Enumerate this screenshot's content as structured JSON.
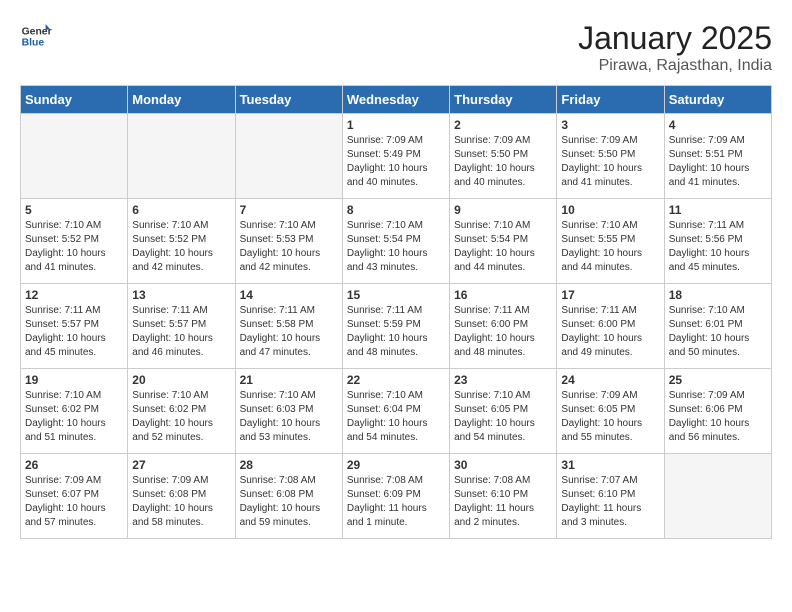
{
  "header": {
    "logo_line1": "General",
    "logo_line2": "Blue",
    "month": "January 2025",
    "location": "Pirawa, Rajasthan, India"
  },
  "weekdays": [
    "Sunday",
    "Monday",
    "Tuesday",
    "Wednesday",
    "Thursday",
    "Friday",
    "Saturday"
  ],
  "weeks": [
    [
      {
        "day": "",
        "detail": ""
      },
      {
        "day": "",
        "detail": ""
      },
      {
        "day": "",
        "detail": ""
      },
      {
        "day": "1",
        "detail": "Sunrise: 7:09 AM\nSunset: 5:49 PM\nDaylight: 10 hours\nand 40 minutes."
      },
      {
        "day": "2",
        "detail": "Sunrise: 7:09 AM\nSunset: 5:50 PM\nDaylight: 10 hours\nand 40 minutes."
      },
      {
        "day": "3",
        "detail": "Sunrise: 7:09 AM\nSunset: 5:50 PM\nDaylight: 10 hours\nand 41 minutes."
      },
      {
        "day": "4",
        "detail": "Sunrise: 7:09 AM\nSunset: 5:51 PM\nDaylight: 10 hours\nand 41 minutes."
      }
    ],
    [
      {
        "day": "5",
        "detail": "Sunrise: 7:10 AM\nSunset: 5:52 PM\nDaylight: 10 hours\nand 41 minutes."
      },
      {
        "day": "6",
        "detail": "Sunrise: 7:10 AM\nSunset: 5:52 PM\nDaylight: 10 hours\nand 42 minutes."
      },
      {
        "day": "7",
        "detail": "Sunrise: 7:10 AM\nSunset: 5:53 PM\nDaylight: 10 hours\nand 42 minutes."
      },
      {
        "day": "8",
        "detail": "Sunrise: 7:10 AM\nSunset: 5:54 PM\nDaylight: 10 hours\nand 43 minutes."
      },
      {
        "day": "9",
        "detail": "Sunrise: 7:10 AM\nSunset: 5:54 PM\nDaylight: 10 hours\nand 44 minutes."
      },
      {
        "day": "10",
        "detail": "Sunrise: 7:10 AM\nSunset: 5:55 PM\nDaylight: 10 hours\nand 44 minutes."
      },
      {
        "day": "11",
        "detail": "Sunrise: 7:11 AM\nSunset: 5:56 PM\nDaylight: 10 hours\nand 45 minutes."
      }
    ],
    [
      {
        "day": "12",
        "detail": "Sunrise: 7:11 AM\nSunset: 5:57 PM\nDaylight: 10 hours\nand 45 minutes."
      },
      {
        "day": "13",
        "detail": "Sunrise: 7:11 AM\nSunset: 5:57 PM\nDaylight: 10 hours\nand 46 minutes."
      },
      {
        "day": "14",
        "detail": "Sunrise: 7:11 AM\nSunset: 5:58 PM\nDaylight: 10 hours\nand 47 minutes."
      },
      {
        "day": "15",
        "detail": "Sunrise: 7:11 AM\nSunset: 5:59 PM\nDaylight: 10 hours\nand 48 minutes."
      },
      {
        "day": "16",
        "detail": "Sunrise: 7:11 AM\nSunset: 6:00 PM\nDaylight: 10 hours\nand 48 minutes."
      },
      {
        "day": "17",
        "detail": "Sunrise: 7:11 AM\nSunset: 6:00 PM\nDaylight: 10 hours\nand 49 minutes."
      },
      {
        "day": "18",
        "detail": "Sunrise: 7:10 AM\nSunset: 6:01 PM\nDaylight: 10 hours\nand 50 minutes."
      }
    ],
    [
      {
        "day": "19",
        "detail": "Sunrise: 7:10 AM\nSunset: 6:02 PM\nDaylight: 10 hours\nand 51 minutes."
      },
      {
        "day": "20",
        "detail": "Sunrise: 7:10 AM\nSunset: 6:02 PM\nDaylight: 10 hours\nand 52 minutes."
      },
      {
        "day": "21",
        "detail": "Sunrise: 7:10 AM\nSunset: 6:03 PM\nDaylight: 10 hours\nand 53 minutes."
      },
      {
        "day": "22",
        "detail": "Sunrise: 7:10 AM\nSunset: 6:04 PM\nDaylight: 10 hours\nand 54 minutes."
      },
      {
        "day": "23",
        "detail": "Sunrise: 7:10 AM\nSunset: 6:05 PM\nDaylight: 10 hours\nand 54 minutes."
      },
      {
        "day": "24",
        "detail": "Sunrise: 7:09 AM\nSunset: 6:05 PM\nDaylight: 10 hours\nand 55 minutes."
      },
      {
        "day": "25",
        "detail": "Sunrise: 7:09 AM\nSunset: 6:06 PM\nDaylight: 10 hours\nand 56 minutes."
      }
    ],
    [
      {
        "day": "26",
        "detail": "Sunrise: 7:09 AM\nSunset: 6:07 PM\nDaylight: 10 hours\nand 57 minutes."
      },
      {
        "day": "27",
        "detail": "Sunrise: 7:09 AM\nSunset: 6:08 PM\nDaylight: 10 hours\nand 58 minutes."
      },
      {
        "day": "28",
        "detail": "Sunrise: 7:08 AM\nSunset: 6:08 PM\nDaylight: 10 hours\nand 59 minutes."
      },
      {
        "day": "29",
        "detail": "Sunrise: 7:08 AM\nSunset: 6:09 PM\nDaylight: 11 hours\nand 1 minute."
      },
      {
        "day": "30",
        "detail": "Sunrise: 7:08 AM\nSunset: 6:10 PM\nDaylight: 11 hours\nand 2 minutes."
      },
      {
        "day": "31",
        "detail": "Sunrise: 7:07 AM\nSunset: 6:10 PM\nDaylight: 11 hours\nand 3 minutes."
      },
      {
        "day": "",
        "detail": ""
      }
    ]
  ]
}
